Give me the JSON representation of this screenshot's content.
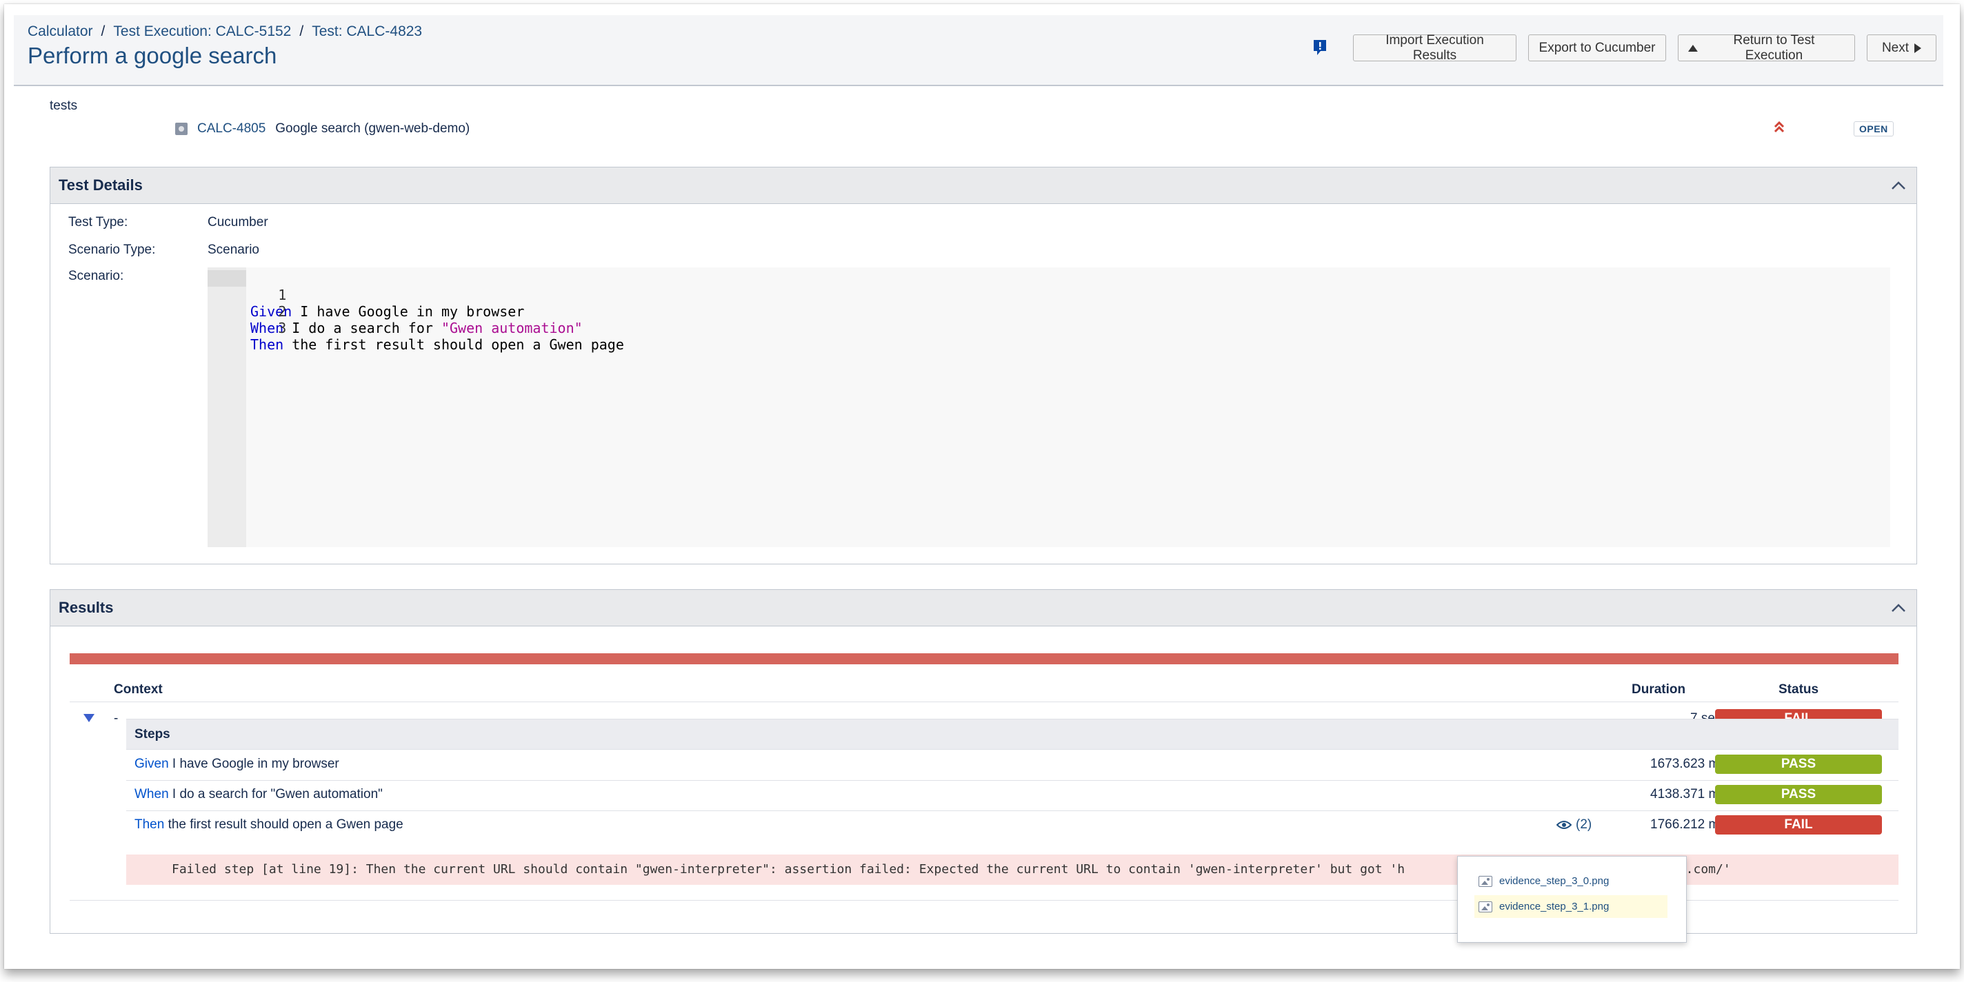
{
  "breadcrumb": {
    "project": "Calculator",
    "execution": "Test Execution: CALC-5152",
    "test": "Test: CALC-4823",
    "separator": "/"
  },
  "page_title": "Perform a google search",
  "toolbar": {
    "import_label": "Import Execution Results",
    "export_label": "Export to Cucumber",
    "return_label": "Return to Test Execution",
    "next_label": "Next"
  },
  "tests": {
    "label": "tests",
    "key": "CALC-4805",
    "summary": "Google search (gwen-web-demo)",
    "status": "OPEN"
  },
  "test_details": {
    "title": "Test Details",
    "test_type_label": "Test Type:",
    "test_type_value": "Cucumber",
    "scenario_type_label": "Scenario Type:",
    "scenario_type_value": "Scenario",
    "scenario_label": "Scenario:",
    "lines": [
      {
        "num": "1",
        "kw": "Given",
        "text": " I have Google in my browser",
        "str": ""
      },
      {
        "num": "2",
        "kw": "When",
        "text": " I do a search for ",
        "str": "\"Gwen automation\""
      },
      {
        "num": "3",
        "kw": "Then",
        "text": " the first result should open a Gwen page",
        "str": ""
      }
    ]
  },
  "results": {
    "title": "Results",
    "headers": {
      "context": "Context",
      "duration": "Duration",
      "status": "Status"
    },
    "context_row": {
      "context": "-",
      "duration": "7 sec",
      "status": "FAIL"
    },
    "steps_header": "Steps",
    "steps": [
      {
        "kw": "Given",
        "text": " I have Google in my browser",
        "duration": "1673.623 ms",
        "status": "PASS"
      },
      {
        "kw": "When",
        "text": " I do a search for \"Gwen automation\"",
        "duration": "4138.371 ms",
        "status": "PASS"
      },
      {
        "kw": "Then",
        "text": " the first result should open a Gwen page",
        "duration": "1766.212 ms",
        "status": "FAIL",
        "evidence_count": "(2)"
      }
    ],
    "error_message": "Failed step [at line 19]: Then the current URL should contain \"gwen-interpreter\": assertion failed: Expected the current URL to contain 'gwen-interpreter' but got 'h",
    "error_tail": "ss.com/'"
  },
  "evidence_popup": {
    "files": [
      "evidence_step_3_0.png",
      "evidence_step_3_1.png"
    ]
  },
  "colors": {
    "link": "#205081",
    "fail": "#d04437",
    "pass": "#8eb021",
    "progress_fail": "#d5655c",
    "keyword": "#0000cc",
    "string": "#aa0d91"
  }
}
